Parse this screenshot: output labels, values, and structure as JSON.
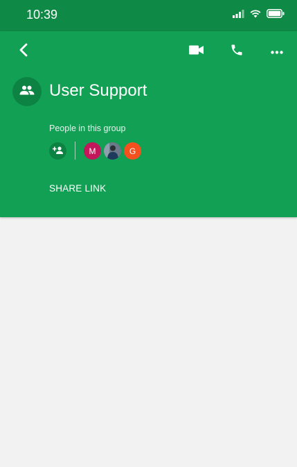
{
  "status_bar": {
    "time": "10:39"
  },
  "header": {
    "title": "User Support",
    "people_label": "People in this group",
    "share_link": "SHARE LINK",
    "members": [
      {
        "initial": "M",
        "color": "#c2185b"
      },
      {
        "initial": "",
        "color": "#3b4552"
      },
      {
        "initial": "G",
        "color": "#f4511e"
      }
    ]
  },
  "icons": {
    "back": "back-arrow-icon",
    "video": "video-call-icon",
    "call": "phone-icon",
    "more": "more-horizontal-icon",
    "group": "group-people-icon",
    "add_person": "person-add-icon"
  },
  "colors": {
    "status_bar": "#0f8a46",
    "header": "#12a055",
    "avatar_bg": "#0d8343",
    "body_bg": "#f2f2f2"
  }
}
